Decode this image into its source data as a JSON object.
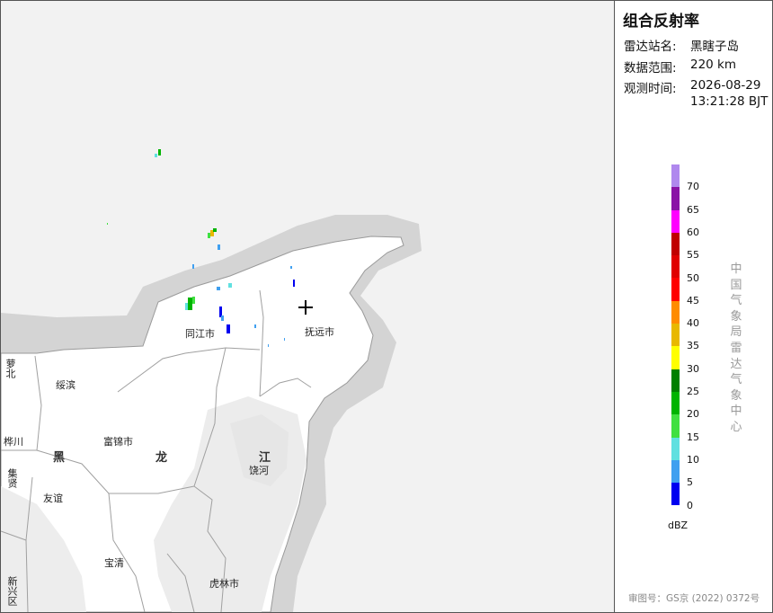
{
  "product": {
    "title": "组合反射率",
    "station_label": "雷达站名:",
    "station_value": "黑瞎子岛",
    "range_label": "数据范围:",
    "range_value": "220 km",
    "time_label": "观测时间:",
    "time_date": "2026-08-29",
    "time_clock": "13:21:28 BJT"
  },
  "legend": {
    "unit": "dBZ",
    "ticks": [
      "70",
      "65",
      "60",
      "55",
      "50",
      "45",
      "40",
      "35",
      "30",
      "25",
      "20",
      "15",
      "10",
      "5",
      "0"
    ],
    "colors": [
      "#b088ee",
      "#8a12a6",
      "#ff00ff",
      "#c00000",
      "#e00000",
      "#ff0000",
      "#ff8c00",
      "#e8b800",
      "#ffff00",
      "#008000",
      "#00b400",
      "#40e040",
      "#60e0e0",
      "#40a0f0",
      "#0000f0"
    ]
  },
  "agency": "中国气象局雷达气象中心",
  "approval": "审图号：GS京 (2022) 0372号",
  "map_labels": {
    "tongjiang": "同江市",
    "fuyuan": "抚远市",
    "suibin": "绥滨",
    "fujin": "富锦市",
    "rao_he": "饶河",
    "youyi": "友谊",
    "baoqing": "宝清",
    "hulin": "虎林市",
    "hua_chuan": "桦川",
    "luobei": "萝北",
    "jixian": "集贤",
    "xingkai": "新兴区",
    "hei": "黑",
    "long": "龙",
    "jiang": "江"
  },
  "map_colors": {
    "land": "#ffffff",
    "buffer": "#d4d4d4",
    "sea": "#f2f2f2",
    "border": "#9a9a9a"
  }
}
